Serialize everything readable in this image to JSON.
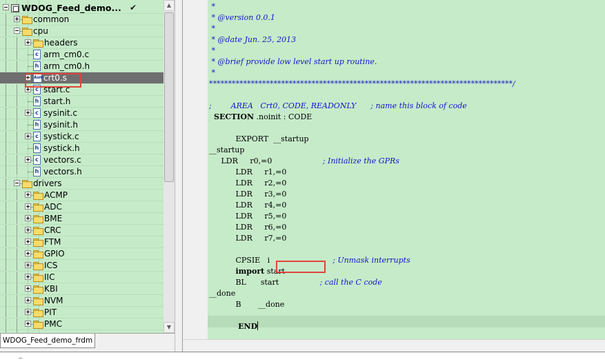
{
  "project_tree": {
    "rows": [
      {
        "label": "WDOG_Feed_demo...",
        "type": "project",
        "expander": "expanded",
        "depth": 0,
        "checked": true
      },
      {
        "label": "common",
        "type": "folder",
        "expander": "collapsed",
        "depth": 1
      },
      {
        "label": "cpu",
        "type": "folder",
        "expander": "expanded",
        "depth": 1
      },
      {
        "label": "headers",
        "type": "folder",
        "expander": "collapsed",
        "depth": 2
      },
      {
        "label": "arm_cm0.c",
        "type": "c-file",
        "expander": "none",
        "depth": 2
      },
      {
        "label": "arm_cm0.h",
        "type": "h-file",
        "expander": "none",
        "depth": 2
      },
      {
        "label": "crt0.s",
        "type": "asm-file",
        "expander": "collapsed",
        "depth": 2,
        "selected": true
      },
      {
        "label": "start.c",
        "type": "c-file",
        "expander": "collapsed",
        "depth": 2
      },
      {
        "label": "start.h",
        "type": "h-file",
        "expander": "none",
        "depth": 2
      },
      {
        "label": "sysinit.c",
        "type": "c-file",
        "expander": "collapsed",
        "depth": 2
      },
      {
        "label": "sysinit.h",
        "type": "h-file",
        "expander": "none",
        "depth": 2
      },
      {
        "label": "systick.c",
        "type": "c-file",
        "expander": "collapsed",
        "depth": 2
      },
      {
        "label": "systick.h",
        "type": "h-file",
        "expander": "none",
        "depth": 2
      },
      {
        "label": "vectors.c",
        "type": "c-file",
        "expander": "collapsed",
        "depth": 2
      },
      {
        "label": "vectors.h",
        "type": "h-file",
        "expander": "none",
        "depth": 2
      },
      {
        "label": "drivers",
        "type": "folder",
        "expander": "expanded",
        "depth": 1
      },
      {
        "label": "ACMP",
        "type": "folder",
        "expander": "collapsed",
        "depth": 2
      },
      {
        "label": "ADC",
        "type": "folder",
        "expander": "collapsed",
        "depth": 2
      },
      {
        "label": "BME",
        "type": "folder",
        "expander": "collapsed",
        "depth": 2
      },
      {
        "label": "CRC",
        "type": "folder",
        "expander": "collapsed",
        "depth": 2
      },
      {
        "label": "FTM",
        "type": "folder",
        "expander": "collapsed",
        "depth": 2
      },
      {
        "label": "GPIO",
        "type": "folder",
        "expander": "collapsed",
        "depth": 2
      },
      {
        "label": "ICS",
        "type": "folder",
        "expander": "collapsed",
        "depth": 2
      },
      {
        "label": "IIC",
        "type": "folder",
        "expander": "collapsed",
        "depth": 2
      },
      {
        "label": "KBI",
        "type": "folder",
        "expander": "collapsed",
        "depth": 2
      },
      {
        "label": "NVM",
        "type": "folder",
        "expander": "collapsed",
        "depth": 2
      },
      {
        "label": "PIT",
        "type": "folder",
        "expander": "collapsed",
        "depth": 2
      },
      {
        "label": "PMC",
        "type": "folder",
        "expander": "collapsed",
        "depth": 2
      }
    ],
    "check_mark": "✔",
    "file_badges": {
      "c-file": "c",
      "h-file": "h",
      "asm-file": "Asm"
    }
  },
  "tree_tab": {
    "label": "WDOG_Feed_demo_frdm"
  },
  "scrollbar": {
    "up_arrow": "▲",
    "down_arrow": "▼"
  },
  "editor": {
    "lines": [
      [
        {
          "t": " *",
          "c": "comment"
        }
      ],
      [
        {
          "t": " * @version 0.0.1",
          "c": "comment"
        }
      ],
      [
        {
          "t": " *",
          "c": "comment"
        }
      ],
      [
        {
          "t": " * @date Jun. 25, 2013",
          "c": "comment"
        }
      ],
      [
        {
          "t": " *",
          "c": "comment"
        }
      ],
      [
        {
          "t": " * @brief provide low level start up routine.",
          "c": "comment"
        }
      ],
      [
        {
          "t": " *",
          "c": "comment"
        }
      ],
      [
        {
          "t": "********************************************************************************/",
          "c": "comment"
        }
      ],
      [
        {
          "t": "",
          "c": "plain"
        }
      ],
      [
        {
          "t": ";        AREA   Crt0, CODE, READONLY      ; name this block of code",
          "c": "comment"
        }
      ],
      [
        {
          "t": "  ",
          "c": "plain"
        },
        {
          "t": "SECTION",
          "c": "kw"
        },
        {
          "t": " .noinit : CODE",
          "c": "plain"
        }
      ],
      [
        {
          "t": "",
          "c": "plain"
        }
      ],
      [
        {
          "t": "           EXPORT  __startup",
          "c": "plain"
        }
      ],
      [
        {
          "t": "__startup",
          "c": "plain"
        }
      ],
      [
        {
          "t": "     LDR     r0,=0                     ",
          "c": "plain"
        },
        {
          "t": "; Initialize the GPRs",
          "c": "comment"
        }
      ],
      [
        {
          "t": "           LDR     r1,=0",
          "c": "plain"
        }
      ],
      [
        {
          "t": "           LDR     r2,=0",
          "c": "plain"
        }
      ],
      [
        {
          "t": "           LDR     r3,=0",
          "c": "plain"
        }
      ],
      [
        {
          "t": "           LDR     r4,=0",
          "c": "plain"
        }
      ],
      [
        {
          "t": "           LDR     r5,=0",
          "c": "plain"
        }
      ],
      [
        {
          "t": "           LDR     r6,=0",
          "c": "plain"
        }
      ],
      [
        {
          "t": "           LDR     r7,=0",
          "c": "plain"
        }
      ],
      [
        {
          "t": "",
          "c": "plain"
        }
      ],
      [
        {
          "t": "           CPSIE   i                          ",
          "c": "plain"
        },
        {
          "t": "; Unmask interrupts",
          "c": "comment"
        }
      ],
      [
        {
          "t": "           ",
          "c": "plain"
        },
        {
          "t": "import",
          "c": "kw"
        },
        {
          "t": " start",
          "c": "plain"
        }
      ],
      [
        {
          "t": "           BL      start                 ",
          "c": "plain"
        },
        {
          "t": "; call the C code",
          "c": "comment"
        }
      ],
      [
        {
          "t": "__done",
          "c": "plain"
        }
      ],
      [
        {
          "t": "           B       __done",
          "c": "plain"
        }
      ],
      [
        {
          "t": "",
          "c": "plain"
        }
      ],
      [
        {
          "t": "           END",
          "c": "kw"
        },
        {
          "t": "",
          "c": "caret"
        }
      ]
    ]
  },
  "colors": {
    "panel_background": "#c6ebc9",
    "selection": "#6e6e6e",
    "comment": "#1414c8",
    "highlight_box": "#e0443a"
  }
}
